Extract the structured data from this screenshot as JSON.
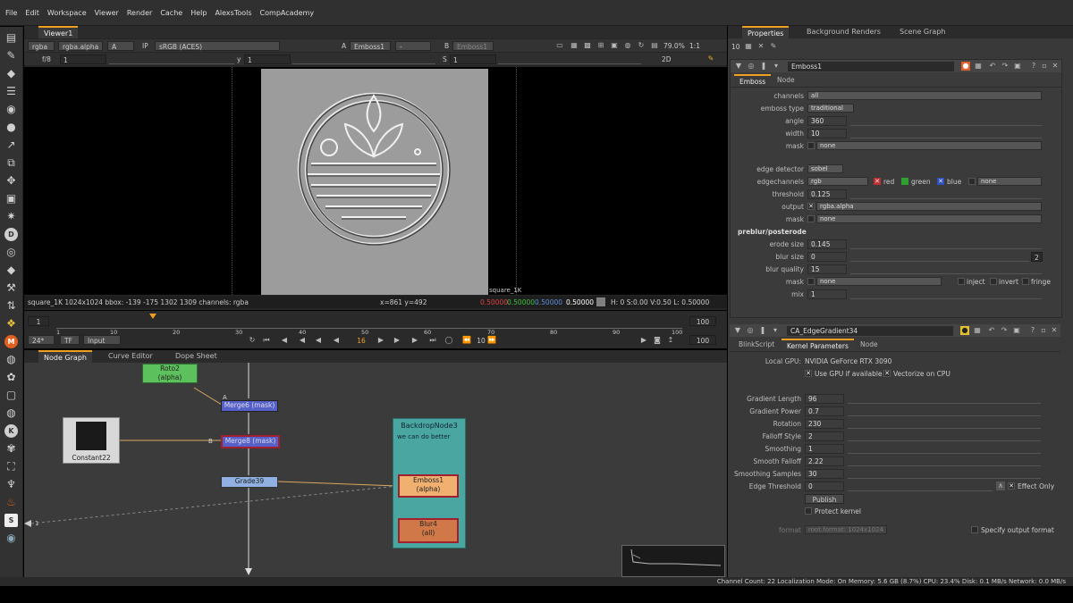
{
  "menu": [
    "File",
    "Edit",
    "Workspace",
    "Viewer",
    "Render",
    "Cache",
    "Help",
    "AlexsTools",
    "CompAcademy"
  ],
  "viewer": {
    "tab": "Viewer1",
    "channel": "rgba",
    "alpha_channel": "rgba.alpha",
    "input_a_letter": "A",
    "ip": "IP",
    "colorspace": "sRGB (ACES)",
    "a_label": "A",
    "a_node": "Emboss1",
    "a_dash": "-",
    "b_label": "B",
    "b_node": "Emboss1",
    "zoom": "79.0%",
    "ratio": "1:1",
    "fstop": "f/8",
    "gain": "1",
    "y_label": "y",
    "y_value": "1",
    "s_label": "S",
    "s_value": "1",
    "mode_2d": "2D",
    "image_label": "square_1K",
    "info_left": "square_1K 1024x1024  bbox: -139 -175 1302 1309 channels: rgba",
    "coords": "x=861 y=492",
    "pixel_r": "0.50000",
    "pixel_g": "0.50000",
    "pixel_b": "0.50000",
    "pixel_a": "0.50000",
    "hsv": "H:  0 S:0.00 V:0.50  L: 0.50000"
  },
  "timeline": {
    "start": "1",
    "end": "100",
    "ticks": [
      "1",
      "10",
      "20",
      "30",
      "40",
      "50",
      "60",
      "70",
      "80",
      "90",
      "100"
    ],
    "current_marker": "16",
    "fps": "24*",
    "tf": "TF",
    "input": "Input",
    "frame": "16",
    "step": "10",
    "end_field": "100"
  },
  "node_graph": {
    "tabs": [
      "Node Graph",
      "Curve Editor",
      "Dope Sheet"
    ],
    "nodes": {
      "roto": "Roto2\n(alpha)",
      "merge6": "Merge6 (mask)",
      "merge8": "Merge8 (mask)",
      "constant": "Constant22",
      "grade": "Grade39",
      "backdrop_title": "BackdropNode3",
      "backdrop_note": "we can do better",
      "emboss": "Emboss1\n(alpha)",
      "blur": "Blur4\n(all)",
      "a_label": "A",
      "b_label": "B",
      "out_label": "1"
    }
  },
  "properties": {
    "tabs": [
      "Properties",
      "Background Renders",
      "Scene Graph"
    ],
    "max_panels": "10",
    "emboss": {
      "name": "Emboss1",
      "tabs": [
        "Emboss",
        "Node"
      ],
      "channels_label": "channels",
      "channels": "all",
      "type_label": "emboss type",
      "type": "traditional",
      "angle_label": "angle",
      "angle": "360",
      "width_label": "width",
      "width": "10",
      "mask_label": "mask",
      "mask": "none",
      "edge_detector_label": "edge detector",
      "edge_detector": "sobel",
      "edgechannels_label": "edgechannels",
      "edgechannels": "rgb",
      "red": "red",
      "green": "green",
      "blue": "blue",
      "edge_extra": "none",
      "threshold_label": "threshold",
      "threshold": "0.125",
      "output_label": "output",
      "output": "rgba.alpha",
      "mask2_label": "mask",
      "mask2": "none",
      "section": "preblur/posterode",
      "erode_label": "erode size",
      "erode": "0.145",
      "blur_label": "blur size",
      "blur": "0",
      "blur_badge": "2",
      "quality_label": "blur quality",
      "quality": "15",
      "mask3_label": "mask",
      "mask3": "none",
      "inject": "inject",
      "invert": "invert",
      "fringe": "fringe",
      "mix_label": "mix",
      "mix": "1"
    },
    "gradient": {
      "name": "CA_EdgeGradient34",
      "tabs": [
        "BlinkScript",
        "Kernel Parameters",
        "Node"
      ],
      "gpu_label": "Local GPU:",
      "gpu": "NVIDIA GeForce RTX 3090",
      "use_gpu": "Use GPU if available",
      "vectorize": "Vectorize on CPU",
      "params": [
        {
          "label": "Gradient Length",
          "value": "96"
        },
        {
          "label": "Gradient Power",
          "value": "0.7"
        },
        {
          "label": "Rotation",
          "value": "230"
        },
        {
          "label": "Falloff Style",
          "value": "2"
        },
        {
          "label": "Smoothing",
          "value": "1"
        },
        {
          "label": "Smooth Falloff",
          "value": "2.22"
        },
        {
          "label": "Smoothing Samples",
          "value": "30"
        },
        {
          "label": "Edge Threshold",
          "value": "0"
        }
      ],
      "effect_only": "Effect Only",
      "publish": "Publish",
      "protect": "Protect kernel",
      "format_label": "format",
      "format_value": "root.format: 1024x1024",
      "specify": "Specify output format"
    }
  },
  "status": "Channel Count: 22  Localization Mode: On  Memory: 5.6 GB (8.7%)  CPU: 23.4%  Disk: 0.1 MB/s  Network: 0.0 MB/s",
  "colors": {
    "accent": "#f0a020",
    "panel": "#393939",
    "viewer_bg": "#000000",
    "backdrop": "#4aa6a0"
  }
}
